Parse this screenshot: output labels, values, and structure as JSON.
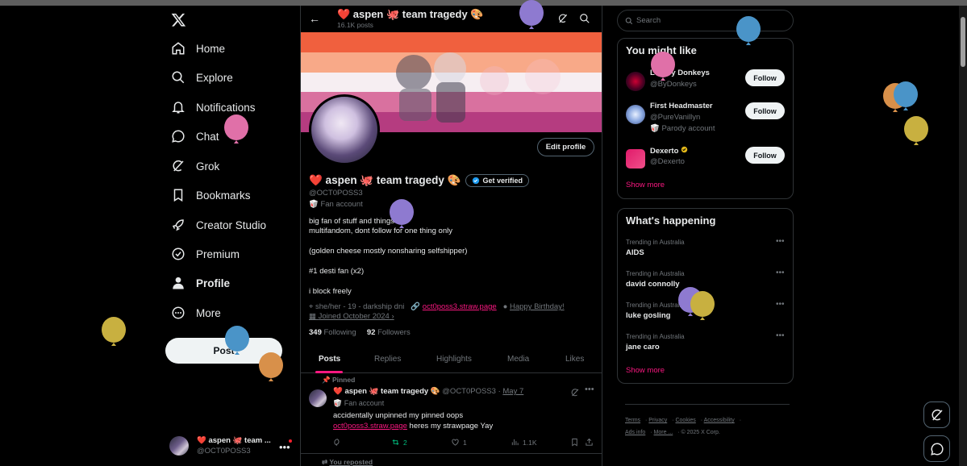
{
  "nav": {
    "items": [
      {
        "label": "Home",
        "icon": "home-icon"
      },
      {
        "label": "Explore",
        "icon": "search-icon"
      },
      {
        "label": "Notifications",
        "icon": "bell-icon"
      },
      {
        "label": "Chat",
        "icon": "chat-icon"
      },
      {
        "label": "Grok",
        "icon": "grok-icon"
      },
      {
        "label": "Bookmarks",
        "icon": "bookmark-icon"
      },
      {
        "label": "Creator Studio",
        "icon": "rocket-icon"
      },
      {
        "label": "Premium",
        "icon": "premium-icon"
      },
      {
        "label": "Profile",
        "icon": "person-icon"
      },
      {
        "label": "More",
        "icon": "more-circle-icon"
      }
    ],
    "post_label": "Post"
  },
  "account": {
    "name": "❤️ aspen 🐙 team ...",
    "handle": "@OCT0POSS3"
  },
  "header": {
    "title": "❤️ aspen 🐙 team tragedy 🎨",
    "posts": "16.1K posts"
  },
  "profile": {
    "edit_label": "Edit profile",
    "name": "❤️ aspen 🐙 team tragedy 🎨",
    "get_verified": "Get verified",
    "handle": "@OCT0POSS3",
    "badge": "🥡 Fan account",
    "bio": [
      "big fan of stuff and things",
      "multifandom, dont follow for one thing only",
      "(golden cheese mostly nonsharing selfshipper)",
      "#1 desti fan (x2)",
      "i block freely"
    ],
    "location": "she/her - 19 - darkship dni",
    "link": "oct0poss3.straw.page",
    "birthday": "Happy Birthday!",
    "joined": "Joined October 2024",
    "following_count": "349",
    "following_label": "Following",
    "followers_count": "92",
    "followers_label": "Followers"
  },
  "tabs": [
    "Posts",
    "Replies",
    "Highlights",
    "Media",
    "Likes"
  ],
  "pinned_tweet": {
    "pinned_label": "Pinned",
    "name": "❤️ aspen 🐙 team tragedy 🎨",
    "handle_date": "@OCT0POSS3 ·",
    "date": "May 7",
    "badge": "🥡 Fan account",
    "line1": "accidentally unpinned my pinned oops",
    "link": "oct0poss3.straw.page",
    "line2_rest": " heres my strawpage Yay",
    "retweets": "2",
    "likes": "1",
    "views": "1.1K"
  },
  "reposted_label": "You reposted",
  "search": {
    "placeholder": "Search"
  },
  "suggestions": {
    "title": "You might like",
    "items": [
      {
        "name": "Led By Donkeys",
        "handle": "@ByDonkeys",
        "extra": ""
      },
      {
        "name": "First Headmaster",
        "handle": "@PureVanillyn",
        "extra": "🥡 Parody account"
      },
      {
        "name": "Dexerto",
        "handle": "@Dexerto",
        "extra": ""
      }
    ],
    "follow_label": "Follow",
    "show_more": "Show more"
  },
  "trends": {
    "title": "What's happening",
    "items": [
      {
        "context": "Trending in Australia",
        "topic": "AIDS"
      },
      {
        "context": "Trending in Australia",
        "topic": "david connolly"
      },
      {
        "context": "Trending in Australia",
        "topic": "luke gosling"
      },
      {
        "context": "Trending in Australia",
        "topic": "jane caro"
      }
    ],
    "show_more": "Show more"
  },
  "footer": {
    "terms": "Terms",
    "privacy": "Privacy",
    "cookies": "Cookies",
    "accessibility": "Accessibility",
    "ads": "Ads info",
    "more": "More ...",
    "copyright": "© 2025 X Corp."
  },
  "colors": {
    "accent": "#f91880",
    "background": "#000000",
    "verified": "#1d9bf0",
    "gold": "#e2b719"
  }
}
